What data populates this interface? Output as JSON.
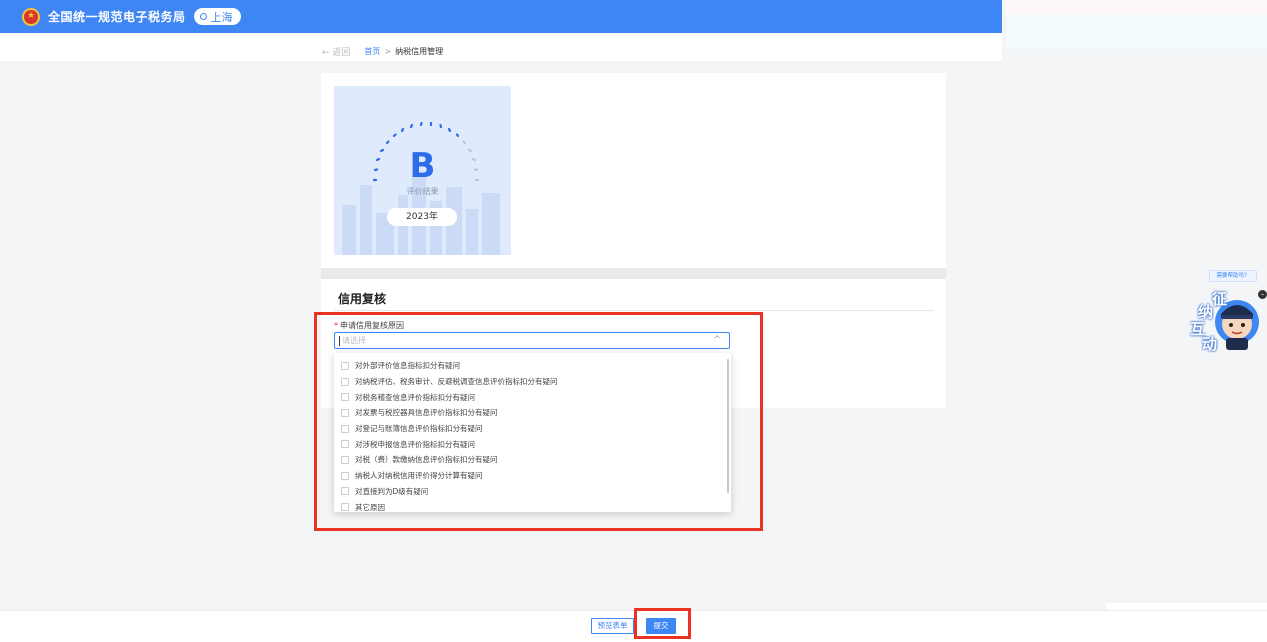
{
  "header": {
    "site_title": "全国统一规范电子税务局",
    "region": "上海"
  },
  "breadcrumb": {
    "back": "返回",
    "home": "首页",
    "separator": ">",
    "current": "纳税信用管理"
  },
  "grade_card": {
    "grade": "B",
    "caption": "评价结果",
    "year": "2023年"
  },
  "form": {
    "section_title": "信用复核",
    "field_label": "申请信用复核原因",
    "required_mark": "*",
    "placeholder": "请选择",
    "options": [
      "对外部评价信息指标扣分有疑问",
      "对纳税评估、税务审计、反避税调查信息评价指标扣分有疑问",
      "对税务稽查信息评价指标扣分有疑问",
      "对发票与税控器具信息评价指标扣分有疑问",
      "对登记与账簿信息评价指标扣分有疑问",
      "对涉税申报信息评价指标扣分有疑问",
      "对税（费）款缴纳信息评价指标扣分有疑问",
      "纳税人对纳税信用评价得分计算有疑问",
      "对直接判为D级有疑问",
      "其它原因"
    ]
  },
  "footer": {
    "preview_label": "预览表单",
    "submit_label": "提交"
  },
  "assistant": {
    "help_text": "需要帮助吗？",
    "chars": [
      "征",
      "纳",
      "互",
      "动"
    ]
  },
  "colors": {
    "primary": "#3e86f3",
    "highlight": "#ea3323"
  }
}
